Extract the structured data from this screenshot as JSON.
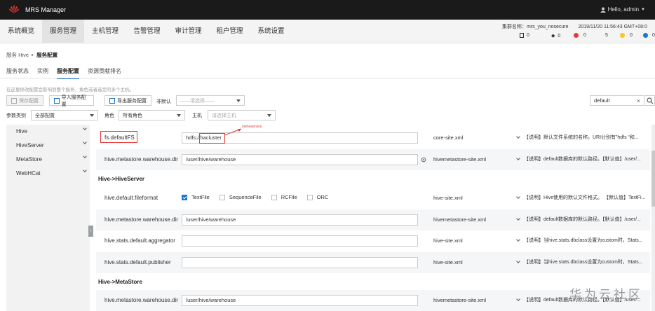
{
  "app": {
    "brand": "MRS Manager",
    "user": "Hello, admin"
  },
  "nav": {
    "items": [
      "系统概览",
      "服务管理",
      "主机管理",
      "告警管理",
      "审计管理",
      "租户管理",
      "系统设置"
    ],
    "active": "服务管理"
  },
  "cluster": {
    "name_label": "集群名称：",
    "name": "mrs_you_nosecure",
    "datetime": "2019/11/20 11:56:43 GMT+08:0",
    "stats": [
      "0",
      "0",
      "0",
      "5",
      "0",
      "0"
    ]
  },
  "breadcrumb": {
    "parent": "服务 Hive",
    "current": "服务配置"
  },
  "tabs": [
    "服务状态",
    "实例",
    "服务配置",
    "资源贡献排名"
  ],
  "hint": "在这里修改配置会影响到整个服务、角色或者选定的多个主机。",
  "toolbar": {
    "save": "保存配置",
    "import": "导入服务配置",
    "export": "导出服务配置",
    "nondefault_label": "非默认",
    "nondefault_placeholder": "——请选择——",
    "search_value": "default",
    "category_label": "参数类别",
    "category_value": "全部配置",
    "role_label": "角色",
    "role_value": "所有角色",
    "host_label": "主机",
    "host_placeholder": "请选择主机"
  },
  "sidebar": {
    "items": [
      "Hive",
      "HiveServer",
      "MetaStore",
      "WebHCat"
    ]
  },
  "annotation": "nameservice",
  "sections": [
    "Hive->HiveServer",
    "Hive->MetaStore"
  ],
  "rows": [
    {
      "name": "fs.defaultFS",
      "value": "hdfs://hacluster",
      "file": "core-site.xml",
      "desc": "【说明】默认文件系统的名称。URI分别有”hdfs “和..."
    },
    {
      "name": "hive.metastore.warehouse.dir",
      "value": "/user/hive/warehouse",
      "file": "hivemetastore-site.xml",
      "desc": "【说明】default数据库的默认路径。【默认值】/user/..."
    },
    {
      "name": "hive.default.fileformat",
      "options": [
        "TextFile",
        "SequenceFile",
        "RCFile",
        "ORC"
      ],
      "file": "hive-site.xml",
      "desc": "【说明】Hive使用的默认文件格式。 【默认值】TextFi..."
    },
    {
      "name": "hive.metastore.warehouse.dir",
      "value": "/user/hive/warehouse",
      "file": "hivemetastore-site.xml",
      "desc": "【说明】default数据库的默认路径。【默认值】/user/..."
    },
    {
      "name": "hive.stats.default.aggregator",
      "value": "",
      "file": "hive-site.xml",
      "desc": "【说明】当hive.stats.dbclass设置为custom时，Stats..."
    },
    {
      "name": "hive.stats.default.publisher",
      "value": "",
      "file": "hive-site.xml",
      "desc": "【说明】当hive.stats.dbclass设置为custom时，Stats..."
    },
    {
      "name": "hive.metastore.warehouse.dir",
      "value": "/user/hive/warehouse",
      "file": "hivemetastore-site.xml",
      "desc": "【说明】default数据库的默认路径。【默认值】/user/..."
    }
  ],
  "watermark": "华为云社区",
  "colors": {
    "accent": "#1976d2",
    "annotation": "#e53935",
    "topbar": "#1a1a1a"
  }
}
